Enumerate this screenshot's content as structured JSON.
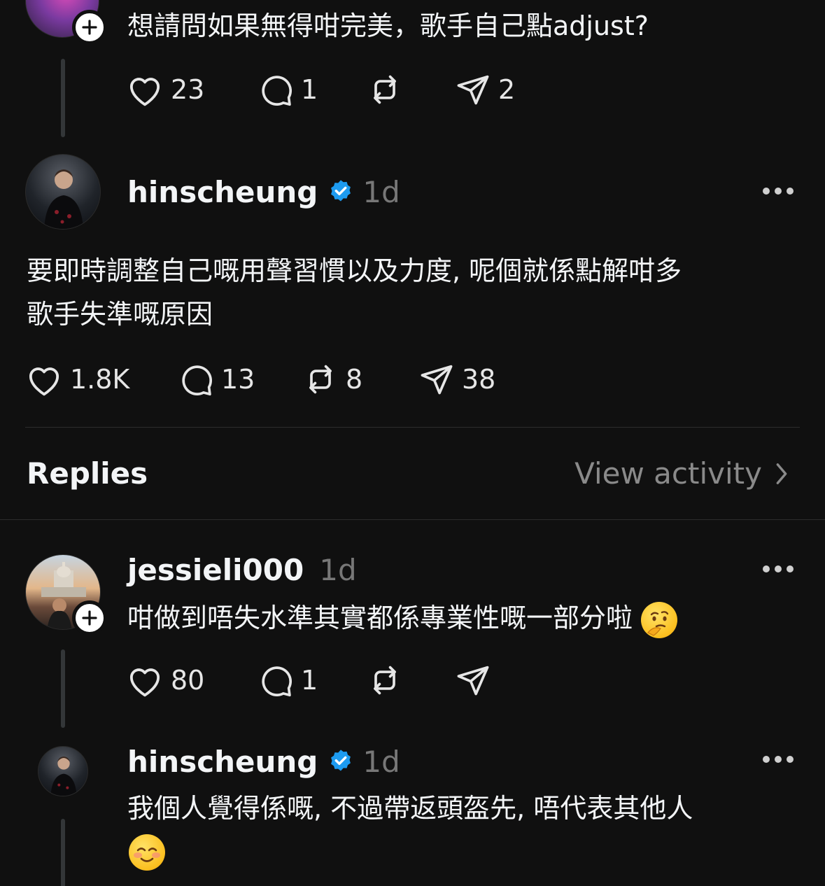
{
  "post_top": {
    "text": "想請問如果無得咁完美，歌手自己點adjust?",
    "likes": "23",
    "replies": "1",
    "reposts": "",
    "shares": "2"
  },
  "post_main": {
    "username": "hinscheung",
    "time": "1d",
    "text_line1": "要即時調整自己嘅用聲習慣以及力度, 呢個就係點解咁多",
    "text_line2": "歌手失準嘅原因",
    "likes": "1.8K",
    "replies": "13",
    "reposts": "8",
    "shares": "38"
  },
  "replies_header": {
    "label": "Replies",
    "view_activity": "View activity"
  },
  "reply_1": {
    "username": "jessieli000",
    "time": "1d",
    "text": "咁做到唔失水準其實都係專業性嘅一部分啦",
    "likes": "80",
    "replies": "1"
  },
  "reply_2": {
    "username": "hinscheung",
    "time": "1d",
    "text": "我個人覺得係嘅, 不過帶返頭盔先, 唔代表其他人"
  },
  "colors": {
    "background": "#101010",
    "text": "#f3f5f7",
    "muted": "#777777",
    "verified": "#1d9bf0",
    "divider": "#2d2d2d"
  },
  "icons": [
    "heart-icon",
    "comment-icon",
    "repost-icon",
    "share-icon",
    "verified-icon",
    "more-icon",
    "chevron-right-icon",
    "plus-icon"
  ]
}
